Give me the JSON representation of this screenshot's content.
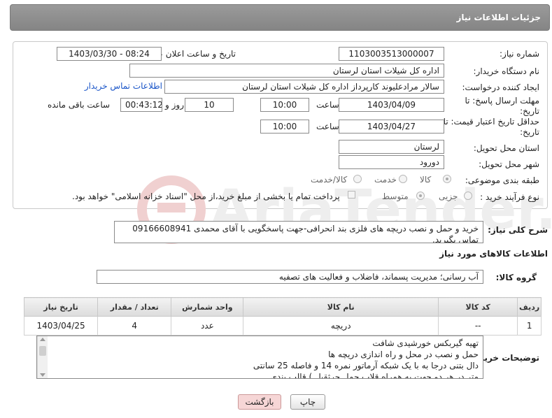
{
  "header": {
    "title": "جزئیات اطلاعات نیاز"
  },
  "form": {
    "need_number_label": "شماره نیاز:",
    "need_number": "1103003513000007",
    "announce_label": "تاریخ و ساعت اعلان عمومی:",
    "announce_value": "1403/03/30 - 08:24",
    "buyer_org_label": "نام دستگاه خریدار:",
    "buyer_org": "اداره کل شیلات استان لرستان",
    "creator_label": "ایجاد کننده درخواست:",
    "creator": "سالار مرادعلیوند کارپرداز اداره کل شیلات استان لرستان",
    "contact_link": "اطلاعات تماس خریدار",
    "deadline_label_1": "مهلت ارسال پاسخ: تا",
    "deadline_label_2": "تاریخ:",
    "deadline_date": "1403/04/09",
    "time_label": "ساعت",
    "deadline_time": "10:00",
    "days_value": "10",
    "days_label": "روز و",
    "remaining_time": "00:43:12",
    "remaining_label": "ساعت باقی مانده",
    "validity_label_1": "حداقل تاریخ اعتبار قیمت: تا",
    "validity_label_2": "تاریخ:",
    "validity_date": "1403/04/27",
    "validity_time_label": "ساعت",
    "validity_time": "10:00",
    "province_label": "استان محل تحویل:",
    "province": "لرستان",
    "city_label": "شهر محل تحویل:",
    "city": "دورود",
    "category_label": "طبقه بندی موضوعی:",
    "category_options": [
      "کالا",
      "خدمت",
      "کالا/خدمت"
    ],
    "process_label": "نوع فرآیند خرید :",
    "process_options": [
      "جزیی",
      "متوسط"
    ],
    "payment_note": "پرداخت تمام یا بخشی از مبلغ خرید،از محل \"اسناد خزانه اسلامی\" خواهد بود."
  },
  "summary": {
    "label": "شرح کلی نیاز:",
    "text": "خرید و حمل و نصب دریچه های فلزی بند انحرافی-جهت پاسخگویی با آقای محمدی 09166608941 تماس بگیرید."
  },
  "goods": {
    "section_title": "اطلاعات کالاهای مورد نیاز",
    "group_label": "گروه کالا:",
    "group_value": "آب رسانی؛ مدیریت پسماند، فاضلاب و فعالیت های تصفیه",
    "columns": [
      "ردیف",
      "کد کالا",
      "نام کالا",
      "واحد شمارش",
      "تعداد / مقدار",
      "تاریخ نیاز"
    ],
    "rows": [
      {
        "row": "1",
        "code": "--",
        "name": "دریچه",
        "unit": "عدد",
        "qty": "4",
        "date": "1403/04/25"
      }
    ]
  },
  "buyer_notes": {
    "label": "توضیحات خریدار:",
    "lines": [
      "تهیه گیربکس خورشیدی شافت",
      "حمل و نصب در محل و راه اندازی دریچه ها",
      "دال بتنی درجا به با یک شبکه آرماتور نمره 14 و فاصله 25 سانتی",
      "متر در هر دو جهت به همراه قلاب حمل جرثقیل ) قالب بندی"
    ]
  },
  "buttons": {
    "print": "چاپ",
    "back": "بازگشت"
  },
  "colors": {
    "header": "#8f8f8f",
    "link": "#1a55c8",
    "back_button": "#f6d6d6"
  }
}
